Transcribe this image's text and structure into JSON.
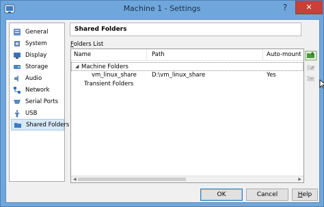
{
  "window": {
    "title": "Machine 1 - Settings",
    "help_label": "?",
    "close_label": "✕"
  },
  "sidebar": {
    "items": [
      {
        "label": "General",
        "icon": "general-icon",
        "color": "#6b8fc9"
      },
      {
        "label": "System",
        "icon": "system-icon",
        "color": "#5f7fa8"
      },
      {
        "label": "Display",
        "icon": "display-icon",
        "color": "#3d6fb5"
      },
      {
        "label": "Storage",
        "icon": "storage-icon",
        "color": "#4a86c5"
      },
      {
        "label": "Audio",
        "icon": "audio-icon",
        "color": "#6a8fb5"
      },
      {
        "label": "Network",
        "icon": "network-icon",
        "color": "#3b74b9"
      },
      {
        "label": "Serial Ports",
        "icon": "serial-ports-icon",
        "color": "#5c89bb"
      },
      {
        "label": "USB",
        "icon": "usb-icon",
        "color": "#3b6fa8"
      },
      {
        "label": "Shared Folders",
        "icon": "shared-folders-icon",
        "color": "#3d7dc3",
        "selected": true
      }
    ]
  },
  "panel": {
    "title": "Shared Folders",
    "folders_list_prefix": "F",
    "folders_list_rest": "olders List"
  },
  "table": {
    "columns": [
      "Name",
      "Path",
      "Auto-mount"
    ],
    "rows": [
      {
        "name": "Machine Folders",
        "path": "",
        "auto": "",
        "arrow": "◢",
        "group": true
      },
      {
        "name": "vm_linux_share",
        "path": "D:\\vm_linux_share",
        "auto": "Yes",
        "arrow": "",
        "group": false
      },
      {
        "name": "Transient Folders",
        "path": "",
        "auto": "",
        "arrow": "",
        "group": true
      }
    ],
    "scroll_left": "◀",
    "scroll_right": "▶"
  },
  "toolbar": {
    "add_icon": "add-folder-icon",
    "edit_icon": "edit-folder-icon",
    "remove_icon": "remove-folder-icon"
  },
  "buttons": {
    "ok": "OK",
    "cancel": "Cancel",
    "help_prefix": "H",
    "help_rest": "elp"
  },
  "colors": {
    "titlebar": "#6fa7dc",
    "close": "#c7403a",
    "selection": "#d7e8f7"
  }
}
